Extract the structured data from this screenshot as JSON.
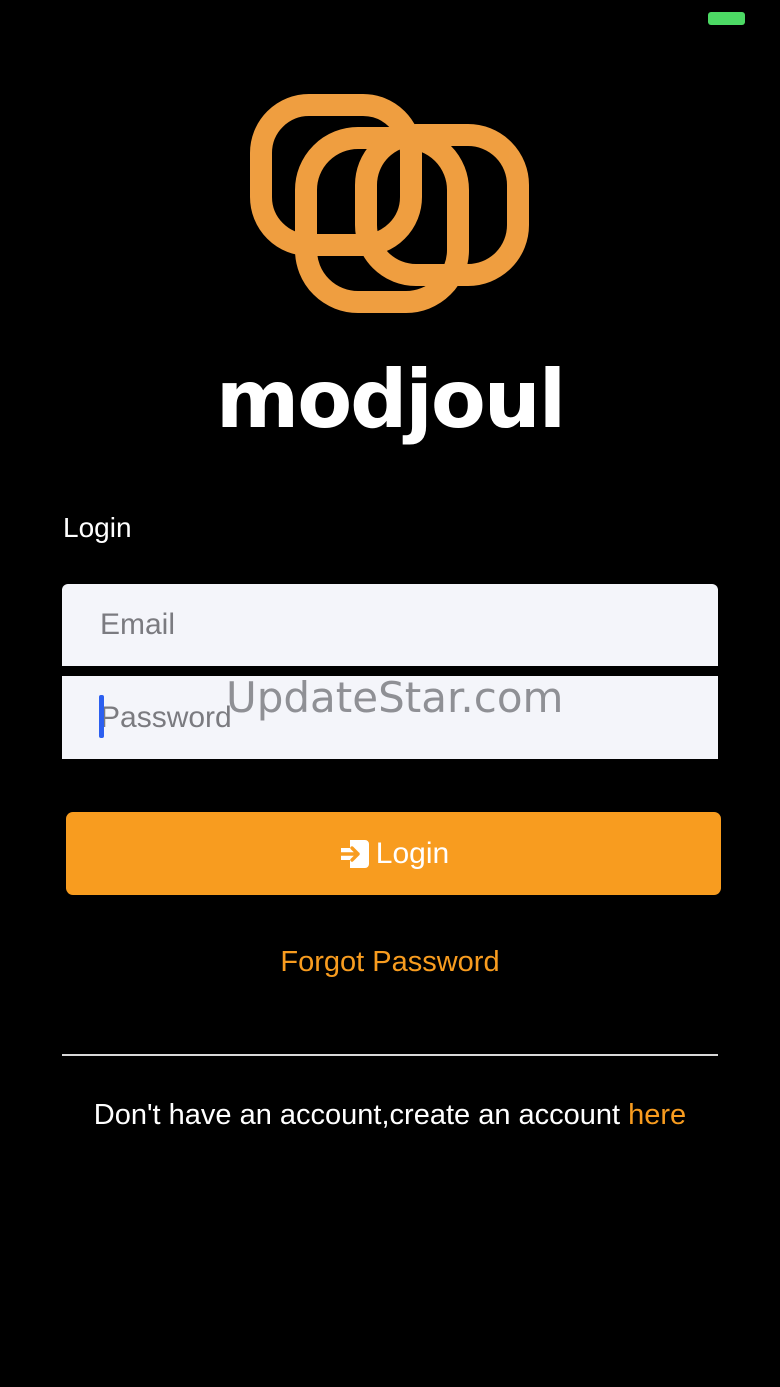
{
  "colors": {
    "background": "#000000",
    "accent": "#f89c1f",
    "logo": "#fca744",
    "battery": "#4cd964",
    "field_background": "#f4f5fa"
  },
  "status_bar": {
    "battery_icon": "battery-icon"
  },
  "brand": {
    "name": "modjoul",
    "logo_icon": "interlocked-squares-logo"
  },
  "form": {
    "title": "Login",
    "email": {
      "placeholder": "Email",
      "value": ""
    },
    "password": {
      "placeholder": "Password",
      "value": ""
    },
    "login_button": {
      "label": "Login",
      "icon": "login-arrow-icon"
    },
    "forgot_password_label": "Forgot Password"
  },
  "watermark": {
    "text": "UpdateStar.com"
  },
  "signup": {
    "text": "Don't have an account,create an account ",
    "link_label": "here"
  }
}
